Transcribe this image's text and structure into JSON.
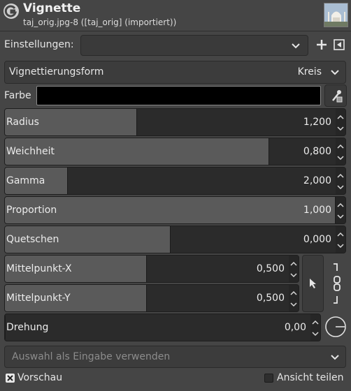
{
  "header": {
    "title": "Vignette",
    "subtitle": "taj_orig.jpg-8 ([taj_orig] (importiert))",
    "logo_icon": "gimp-logo-icon",
    "thumbnail_icon": "image-thumbnail"
  },
  "settings": {
    "label": "Einstellungen:",
    "value": "",
    "add_icon": "plus-icon",
    "menu_icon": "menu-triangle-icon"
  },
  "shape": {
    "label": "Vignettierungsform",
    "value": "Kreis"
  },
  "color": {
    "label": "Farbe",
    "value": "#000000",
    "picker_icon": "eyedropper-icon"
  },
  "sliders": [
    {
      "label": "Radius",
      "value": "1,200",
      "fraction": 0.4
    },
    {
      "label": "Weichheit",
      "value": "0,800",
      "fraction": 0.8
    },
    {
      "label": "Gamma",
      "value": "2,000",
      "fraction": 0.19
    },
    {
      "label": "Proportion",
      "value": "1,000",
      "fraction": 1.0
    },
    {
      "label": "Quetschen",
      "value": "0,000",
      "fraction": 0.5
    }
  ],
  "center": {
    "x": {
      "label": "Mittelpunkt-X",
      "value": "0,500",
      "fraction": 0.5
    },
    "y": {
      "label": "Mittelpunkt-Y",
      "value": "0,500",
      "fraction": 0.5
    },
    "pick_icon": "pointer-icon",
    "chain_icon": "chain-link-icon"
  },
  "rotation": {
    "label": "Drehung",
    "value": "0,00",
    "dial_icon": "rotation-dial-icon"
  },
  "selection": {
    "label": "Auswahl als Eingabe verwenden"
  },
  "footer": {
    "preview_label": "Vorschau",
    "preview_checked": true,
    "split_label": "Ansicht teilen",
    "split_checked": false
  }
}
